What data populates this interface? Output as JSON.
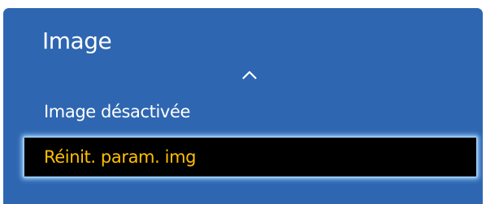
{
  "menu": {
    "title": "Image",
    "scroll_up_icon": "chevron-up-icon",
    "items": [
      {
        "label": "Image désactivée",
        "selected": false
      },
      {
        "label": "Réinit. param. img",
        "selected": true
      }
    ]
  },
  "colors": {
    "panel_background": "#2e66b1",
    "text": "#ffffff",
    "selected_background": "#000000",
    "selected_text": "#ffbf00",
    "focus_glow": "#9fd4ff"
  }
}
